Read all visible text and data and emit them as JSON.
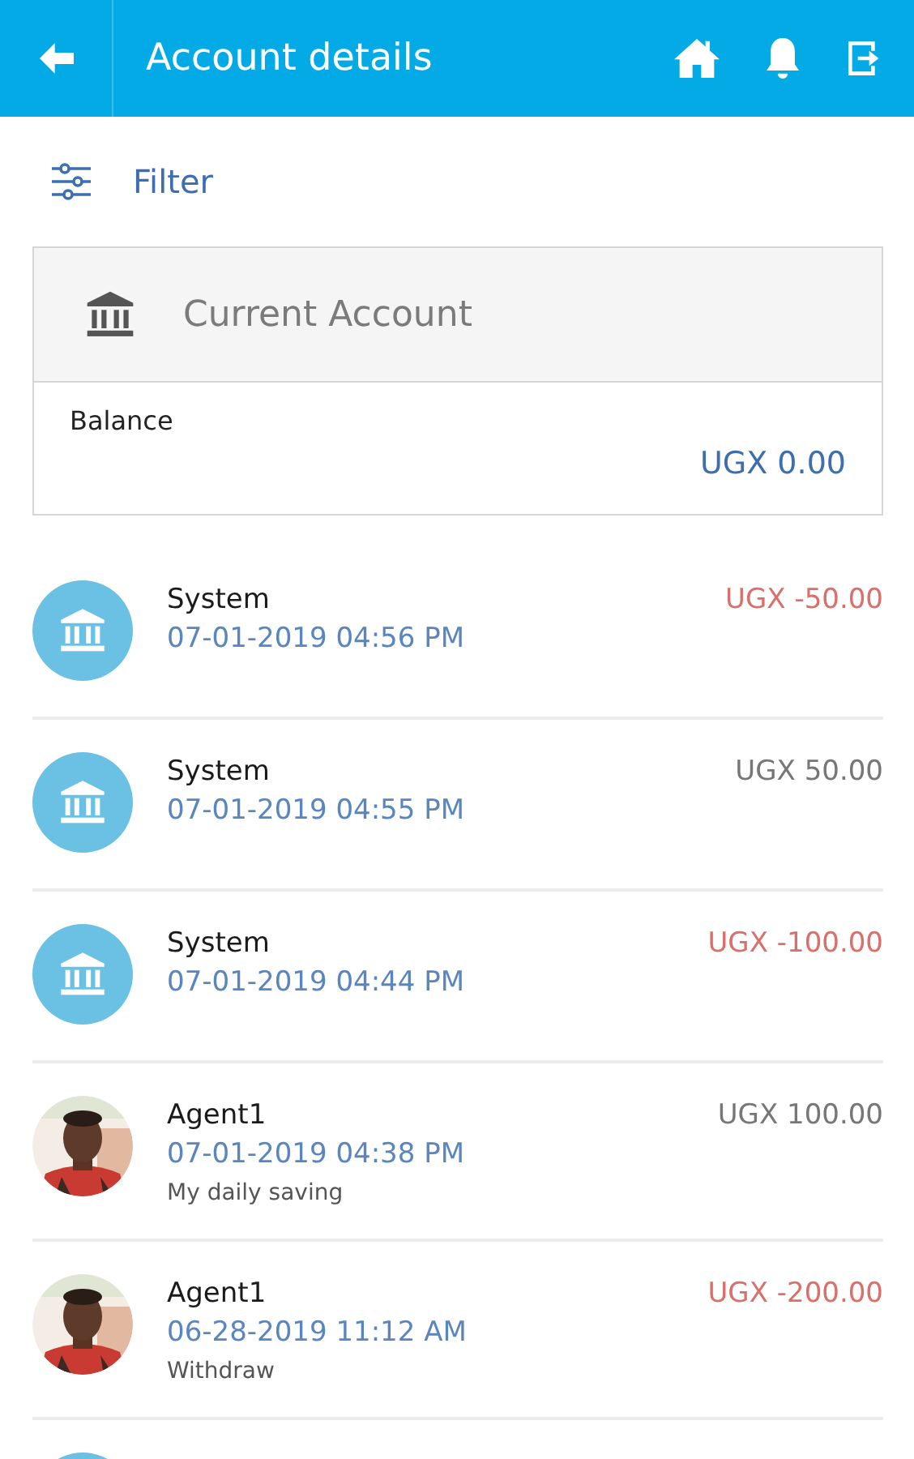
{
  "header": {
    "title": "Account details"
  },
  "filter": {
    "label": "Filter"
  },
  "account": {
    "name": "Current Account",
    "balance_label": "Balance",
    "balance": "UGX 0.00"
  },
  "transactions": [
    {
      "kind": "bank",
      "name": "System",
      "date": "07-01-2019 04:56 PM",
      "amount": "UGX -50.00",
      "debit": true
    },
    {
      "kind": "bank",
      "name": "System",
      "date": "07-01-2019 04:55 PM",
      "amount": "UGX 50.00",
      "debit": false
    },
    {
      "kind": "bank",
      "name": "System",
      "date": "07-01-2019 04:44 PM",
      "amount": "UGX -100.00",
      "debit": true
    },
    {
      "name": "Agent1",
      "date": "07-01-2019 04:38 PM",
      "note": "My daily saving",
      "amount": "UGX 100.00",
      "debit": false
    },
    {
      "name": "Agent1",
      "date": "06-28-2019 11:12 AM",
      "note": "Withdraw",
      "amount": "UGX -200.00",
      "debit": true
    },
    {
      "kind": "bank"
    }
  ]
}
